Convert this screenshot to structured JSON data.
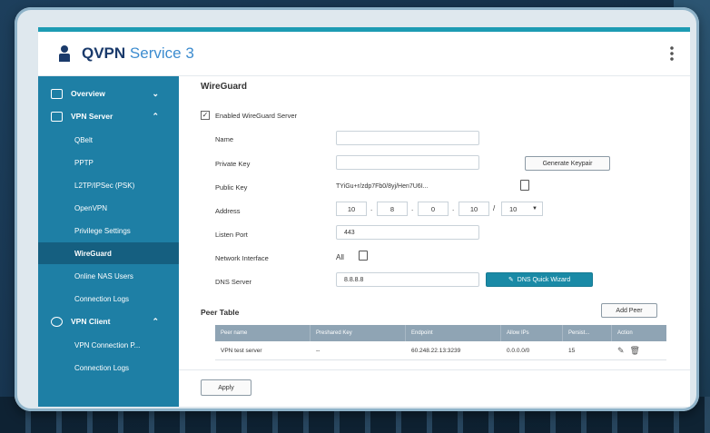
{
  "app": {
    "title_bold": "QVPN",
    "title_light": " Service 3"
  },
  "sidebar": {
    "items": [
      {
        "label": "Overview",
        "type": "section"
      },
      {
        "label": "VPN Server",
        "type": "section"
      },
      {
        "label": "QBelt",
        "type": "sub"
      },
      {
        "label": "PPTP",
        "type": "sub"
      },
      {
        "label": "L2TP/IPSec (PSK)",
        "type": "sub"
      },
      {
        "label": "OpenVPN",
        "type": "sub"
      },
      {
        "label": "Privilege Settings",
        "type": "sub"
      },
      {
        "label": "WireGuard",
        "type": "sub",
        "active": true
      },
      {
        "label": "Online NAS Users",
        "type": "sub"
      },
      {
        "label": "Connection Logs",
        "type": "sub"
      },
      {
        "label": "VPN Client",
        "type": "section"
      },
      {
        "label": "VPN Connection P...",
        "type": "sub"
      },
      {
        "label": "Connection Logs",
        "type": "sub"
      }
    ]
  },
  "main": {
    "title": "WireGuard",
    "enable_label": "Enabled WireGuard Server",
    "form": {
      "name_label": "Name",
      "name_value": "",
      "private_key_label": "Private Key",
      "private_key_value": "",
      "generate_button": "Generate Keypair",
      "public_key_label": "Public Key",
      "public_key_value": "TYiGu+r/zdp7Fb0/8yj/Hen7U6I...",
      "address_label": "Address",
      "address_octets": [
        "10",
        "8",
        "0",
        "10"
      ],
      "address_prefix": "10",
      "listen_port_label": "Listen Port",
      "listen_port_value": "443",
      "interface_label": "Network Interface",
      "interface_value": "All",
      "dns_label": "DNS Server",
      "dns_value": "8.8.8.8",
      "dns_wizard_button": "DNS Quick Wizard"
    },
    "peer_table": {
      "title": "Peer Table",
      "add_button": "Add Peer",
      "columns": [
        "Peer name",
        "Preshared Key",
        "Endpoint",
        "Allow IPs",
        "Persist...",
        "Action"
      ],
      "rows": [
        [
          "VPN test server",
          "--",
          "60.248.22.13:3239",
          "0.0.0.0/0",
          "15",
          ""
        ]
      ]
    },
    "apply_button": "Apply"
  },
  "colors": {
    "sidebar": "#1e7fa5",
    "sidebar_active": "#155f80",
    "accent": "#1d9bb3",
    "primary_button": "#1a8aa6"
  }
}
